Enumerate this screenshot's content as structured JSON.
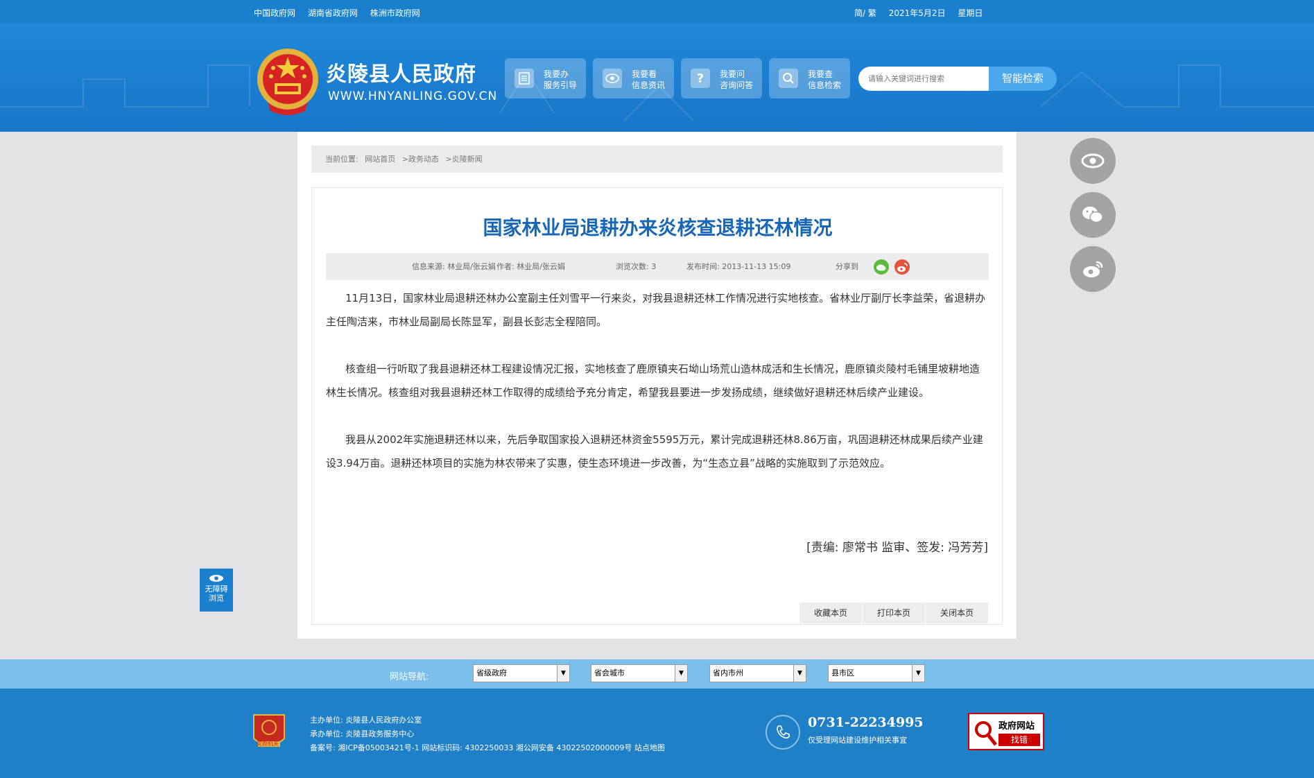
{
  "topbar": {
    "links": [
      "中国政府网",
      "湖南省政府网",
      "株洲市政府网"
    ],
    "lang": "简/ 繁",
    "date": "2021年5月2日",
    "weekday": "星期日"
  },
  "header": {
    "site_name": "炎陵县人民政府",
    "site_url": "WWW.HNYANLING.GOV.CN",
    "quick": [
      {
        "t1": "我要办",
        "t2": "服务引导",
        "icon": "document-icon"
      },
      {
        "t1": "我要看",
        "t2": "信息资讯",
        "icon": "eye-icon"
      },
      {
        "t1": "我要问",
        "t2": "咨询问答",
        "icon": "question-icon"
      },
      {
        "t1": "我要查",
        "t2": "信息检索",
        "icon": "search-icon"
      }
    ],
    "search_placeholder": "请输入关键词进行搜索",
    "search_button": "智能检索"
  },
  "breadcrumb": {
    "label": "当前位置:",
    "items": [
      "网站首页",
      ">政务动态",
      ">炎陵新闻"
    ]
  },
  "article": {
    "title": "国家林业局退耕办来炎核查退耕还林情况",
    "source": "信息来源:  林业局/张云娟",
    "author": "作者:  林业局/张云娟",
    "views": "浏览次数:  3",
    "published": "发布时间:  2013-11-13 15:09",
    "share_label": "分享到",
    "paragraphs": [
      "11月13日，国家林业局退耕还林办公室副主任刘雪平一行来炎，对我县退耕还林工作情况进行实地核查。省林业厅副厅长李益荣，省退耕办主任陶洁来，市林业局副局长陈显军，副县长彭志全程陪同。",
      "核查组一行听取了我县退耕还林工程建设情况汇报，实地核查了鹿原镇夹石坳山场荒山造林成活和生长情况，鹿原镇炎陵村毛铺里坡耕地造林生长情况。核查组对我县退耕还林工作取得的成绩给予充分肯定，希望我县要进一步发扬成绩，继续做好退耕还林后续产业建设。",
      "我县从2002年实施退耕还林以来，先后争取国家投入退耕还林资金5595万元，累计完成退耕还林8.86万亩，巩固退耕还林成果后续产业建设3.94万亩。退耕还林项目的实施为林农带来了实惠，使生态环境进一步改善，为“生态立县”战略的实施取到了示范效应。"
    ],
    "editor": "[责编: 廖常书  监审、签发: 冯芳芳]",
    "actions": [
      "收藏本页",
      "打印本页",
      "关闭本页"
    ]
  },
  "side": {
    "accessibility_l1": "无障碍",
    "accessibility_l2": "浏览"
  },
  "nav": {
    "label": "网站导航:",
    "selects": [
      "省级政府",
      "省会城市",
      "省内市州",
      "县市区"
    ]
  },
  "footer": {
    "host": "主办单位:  炎陵县人民政府办公室",
    "organizer": "承办单位:  炎陵县政务服务中心",
    "record": "备案号:  湘ICP备05003421号-1  网站标识码:  4302250033  湘公网安备 43022502000009号  站点地图",
    "phone": "0731-22234995",
    "phone_note": "仅受理网站建设维护相关事宜",
    "badge_line1": "政府网站",
    "badge_line2": "找错",
    "party_badge": "党政机关"
  },
  "colors": {
    "brand_blue": "#1a7fcc",
    "title_blue": "#1867b7",
    "nav_light": "#7bc0ed"
  }
}
